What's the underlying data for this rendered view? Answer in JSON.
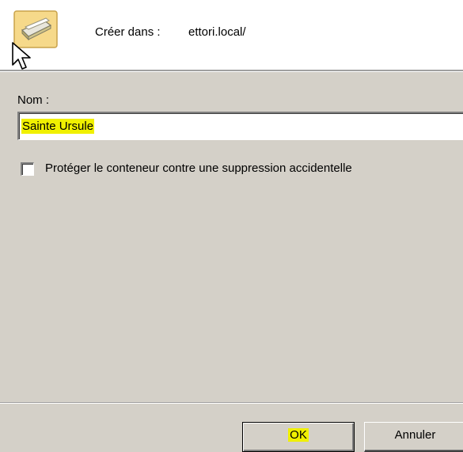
{
  "header": {
    "icon": "folder-container-icon",
    "create_label": "Créer dans :",
    "create_value": "ettori.local/"
  },
  "form": {
    "name_label": "Nom :",
    "name_value": "Sainte Ursule",
    "protect_checkbox_label": "Protéger le conteneur contre une suppression accidentelle",
    "protect_checked": false
  },
  "buttons": {
    "ok_label": "OK",
    "cancel_label": "Annuler"
  },
  "colors": {
    "highlight": "#f0f000",
    "dialog_bg": "#d4d0c8"
  }
}
